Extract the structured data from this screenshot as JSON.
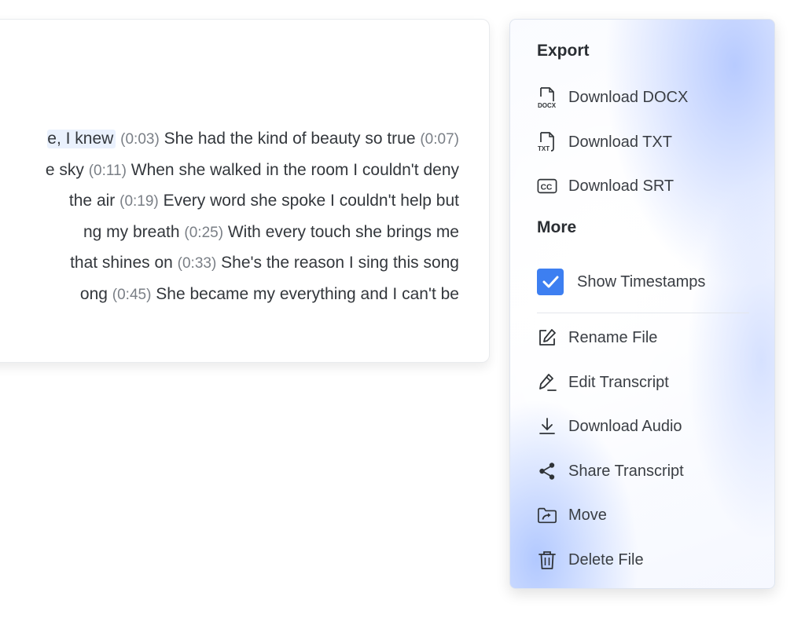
{
  "transcript": {
    "lines": [
      [
        {
          "t": "e, I knew",
          "hl": true
        },
        {
          "t": " "
        },
        {
          "t": "(0:03)",
          "ts": true
        },
        {
          "t": " She had the kind of beauty so true "
        },
        {
          "t": "(0:07)",
          "ts": true
        }
      ],
      [
        {
          "t": "e sky "
        },
        {
          "t": "(0:11)",
          "ts": true
        },
        {
          "t": " When she walked in the room I couldn't deny"
        }
      ],
      [
        {
          "t": "the air "
        },
        {
          "t": "(0:19)",
          "ts": true
        },
        {
          "t": " Every word she spoke I couldn't help but"
        }
      ],
      [
        {
          "t": "ng my breath "
        },
        {
          "t": "(0:25)",
          "ts": true
        },
        {
          "t": " With every touch she brings me"
        }
      ],
      [
        {
          "t": "that shines on "
        },
        {
          "t": "(0:33)",
          "ts": true
        },
        {
          "t": " She's the reason I sing this song"
        }
      ],
      [
        {
          "t": "ong "
        },
        {
          "t": "(0:45)",
          "ts": true
        },
        {
          "t": " She became my everything and I can't be"
        }
      ]
    ]
  },
  "menu": {
    "export_title": "Export",
    "download_docx": "Download DOCX",
    "download_txt": "Download TXT",
    "download_srt": "Download SRT",
    "more_title": "More",
    "show_timestamps": "Show Timestamps",
    "show_timestamps_checked": true,
    "rename_file": "Rename File",
    "edit_transcript": "Edit Transcript",
    "download_audio": "Download Audio",
    "share_transcript": "Share Transcript",
    "move": "Move",
    "delete_file": "Delete File",
    "icon_docx_text": "DOCX",
    "icon_txt_text": "TXT",
    "icon_srt_text": "CC"
  },
  "colors": {
    "accent": "#3d7ff1",
    "highlight": "#eaf1fd",
    "timestamp": "#7a7f86"
  }
}
